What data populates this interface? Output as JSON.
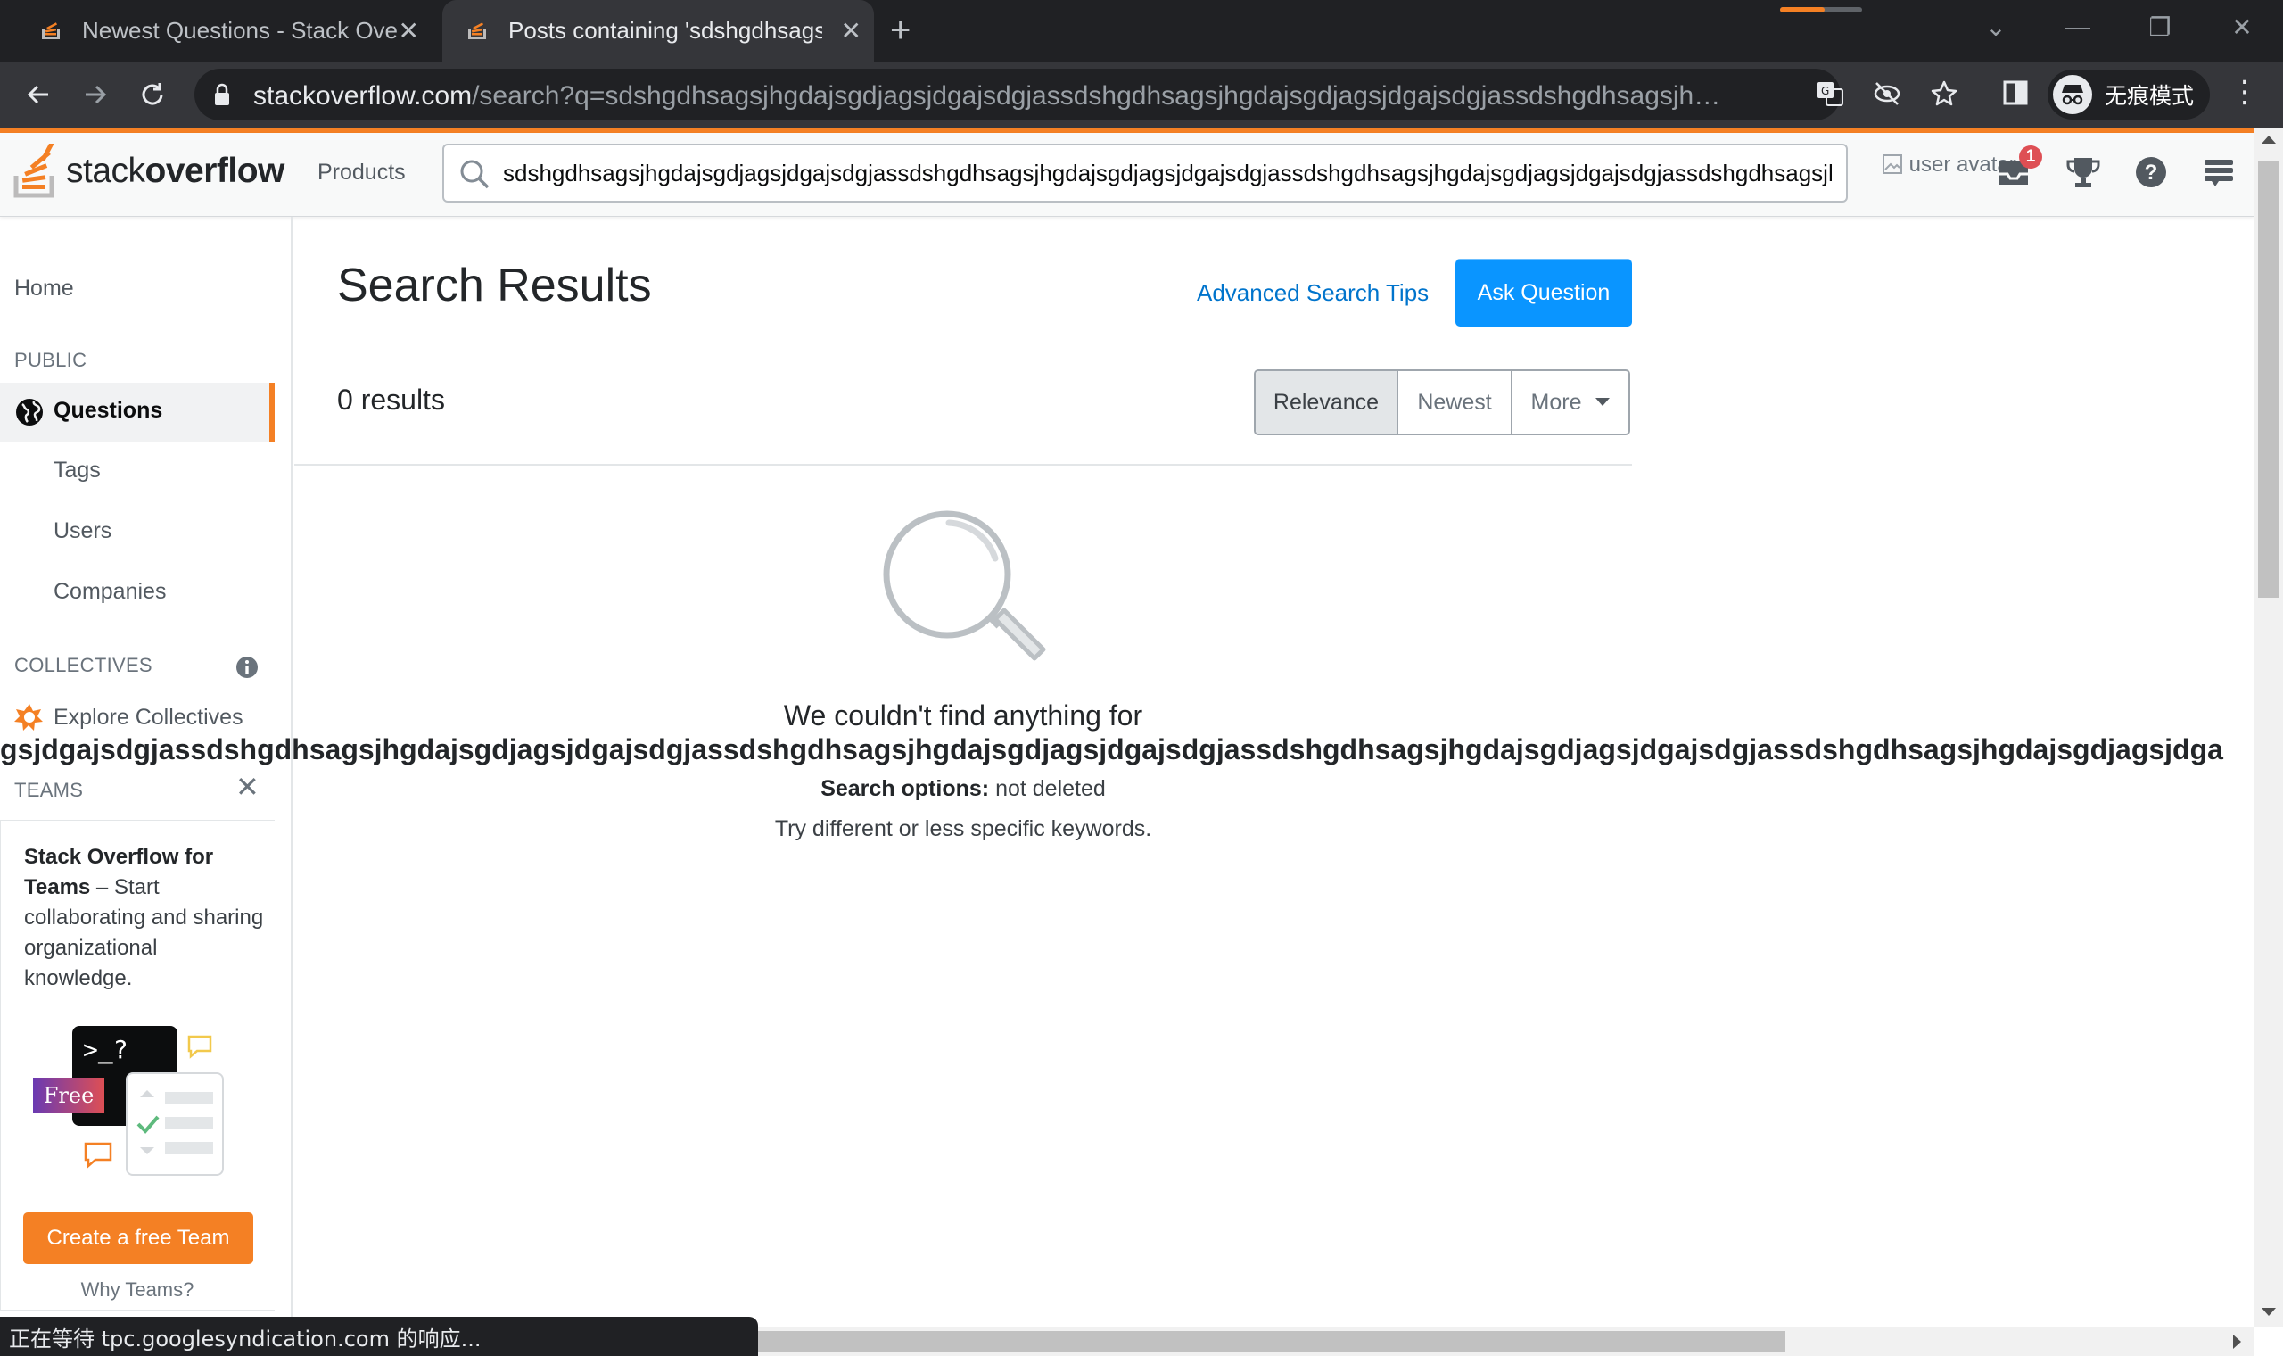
{
  "browser": {
    "tabs": [
      {
        "title": "Newest Questions - Stack Overflow",
        "active": false
      },
      {
        "title": "Posts containing 'sdshgdhsagsjhgdajsgdjagsjdgajsdgjassdshgdhsagsjhgdajsgdjagsjdgajsdgjassdshgdhsagsjhgdajsgdjagsjdgajsdgjassdshgdhsagsjhg' - Stack Overflow",
        "active": true
      }
    ],
    "new_tab_symbol": "+",
    "tab_close_symbol": "✕",
    "window_controls": {
      "dropdown": "⌄",
      "minimize": "—",
      "restore": "❐",
      "close": "✕"
    },
    "url_host": "stackoverflow.com",
    "url_path": "/search?q=sdshgdhsagsjhgdajsgdjagsjdgajsdgjassdshgdhsagsjhgdajsgdjagsjdgajsdgjassdshgdhsagsjhgdajsgdjagsjdgajsdgjassdshgdhsagsjhgdajsg...",
    "profile_label": "无痕模式",
    "status_text": "正在等待 tpc.googlesyndication.com 的响应..."
  },
  "so": {
    "logo_text_light": "stack",
    "logo_text_bold": "overflow",
    "products": "Products",
    "search_value": "sdshgdhsagsjhgdajsgdjagsjdgajsdgjassdshgdhsagsjhgdajsgdjagsjdgajsdgjassdshgdhsagsjhgdajsgdjagsjdgajsdgjassdshgdhsagsjhg",
    "avatar_alt": "user avatar",
    "inbox_badge": "1"
  },
  "sidebar": {
    "home": "Home",
    "public_header": "PUBLIC",
    "questions": "Questions",
    "tags": "Tags",
    "users": "Users",
    "companies": "Companies",
    "collectives_header": "COLLECTIVES",
    "explore_collectives": "Explore Collectives",
    "teams_header": "TEAMS",
    "teams_close": "✕",
    "teams_title": "Stack Overflow for Teams",
    "teams_body": " – Start collaborating and sharing organizational knowledge.",
    "illus_prompt": ">_?",
    "illus_free": "Free",
    "create_team": "Create a free Team",
    "why_teams": "Why Teams?"
  },
  "main": {
    "title": "Search Results",
    "advanced_tips": "Advanced Search Tips",
    "ask_question": "Ask Question",
    "results_count": "0 results",
    "sort_options": [
      "Relevance",
      "Newest",
      "More"
    ],
    "sort_selected": "Relevance",
    "empty_title": "We couldn't find anything for",
    "empty_query": "gsjdgajsdgjassdshgdhsagsjhgdajsgdjagsjdgajsdgjassdshgdhsagsjhgdajsgdjagsjdgajsdgjassdshgdhsagsjhgdajsgdjagsjdgajsdgjassdshgdhsagsjhgdajsgdjagsjdga",
    "search_options_label": "Search options:",
    "search_options_value": " not deleted",
    "try_text": "Try different or less specific keywords."
  },
  "colors": {
    "accent_orange": "#f48024",
    "primary_blue": "#0a95ff",
    "link_blue": "#0074cc",
    "chrome_dark": "#202124"
  }
}
